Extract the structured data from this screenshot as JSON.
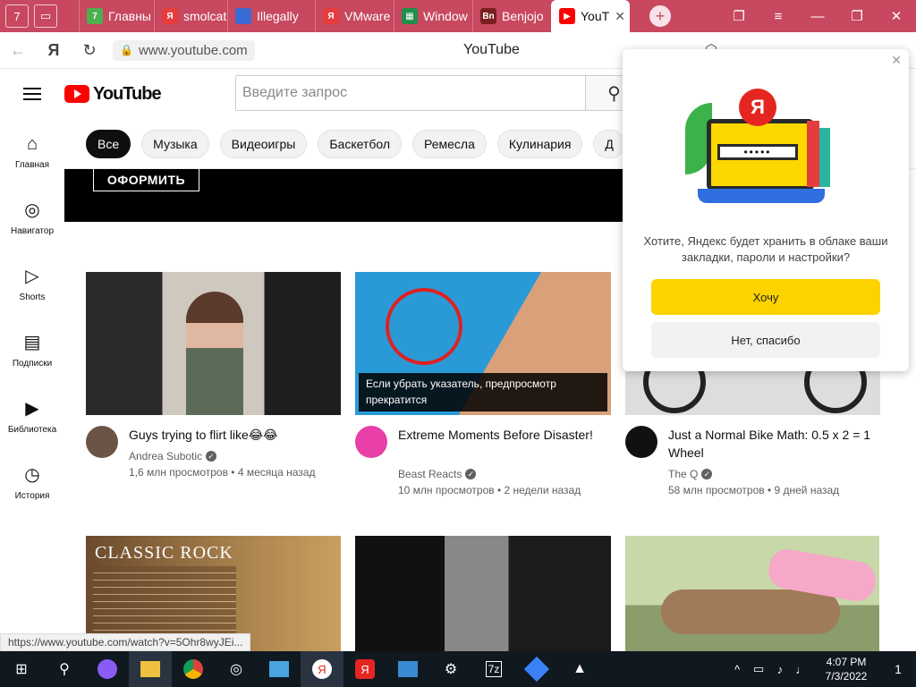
{
  "browser": {
    "tab_count_badge": "7",
    "tabs": [
      {
        "label": "Главны",
        "fav_color": "#4caf50"
      },
      {
        "label": "smolcat",
        "fav_color": "#e53d3d"
      },
      {
        "label": "Illegally",
        "fav_color": "#3a6ad4"
      },
      {
        "label": "VMware",
        "fav_color": "#e53d3d"
      },
      {
        "label": "Window",
        "fav_color": "#1f8f4a"
      },
      {
        "label": "Benjojo",
        "fav_color": "#7a1f1f"
      },
      {
        "label": "YouT",
        "fav_color": "#ff0000"
      }
    ],
    "url": "www.youtube.com",
    "page_title": "YouTube"
  },
  "youtube": {
    "search_placeholder": "Введите запрос",
    "chips": [
      "Все",
      "Музыка",
      "Видеоигры",
      "Баскетбол",
      "Ремесла",
      "Кулинария",
      "Д"
    ],
    "guide": [
      {
        "icon": "⌂",
        "label": "Главная"
      },
      {
        "icon": "◎",
        "label": "Навигатор"
      },
      {
        "icon": "▷",
        "label": "Shorts"
      },
      {
        "icon": "▤",
        "label": "Подписки"
      },
      {
        "icon": "▶",
        "label": "Библиотека"
      },
      {
        "icon": "◷",
        "label": "История"
      }
    ],
    "banner_button": "ОФОРМИТЬ",
    "videos": [
      {
        "title": "Guys trying to flirt like😂😂",
        "channel": "Andrea Subotic",
        "stats": "1,6 млн просмотров • 4 месяца назад"
      },
      {
        "title": "Extreme Moments Before Disaster!",
        "channel": "Beast Reacts",
        "stats": "10 млн просмотров • 2 недели назад",
        "tooltip": "Если убрать указатель, предпросмотр прекратится"
      },
      {
        "title": "Just a Normal Bike Math: 0.5 x 2 = 1 Wheel",
        "channel": "The Q",
        "stats": "58 млн просмотров • 9 дней назад"
      }
    ],
    "classic_rock_title": "CLASSIC ROCK",
    "link_preview": "https://www.youtube.com/watch?v=5Ohr8wyJEi..."
  },
  "popup": {
    "question": "Хотите, Яндекс будет хранить в облаке ваши закладки, пароли и настройки?",
    "yes_label": "Хочу",
    "no_label": "Нет, спасибо",
    "logo_letter": "Я",
    "password_dots": "•••••"
  },
  "taskbar": {
    "time": "4:07 PM",
    "date": "7/3/2022",
    "notif_count": "1"
  }
}
